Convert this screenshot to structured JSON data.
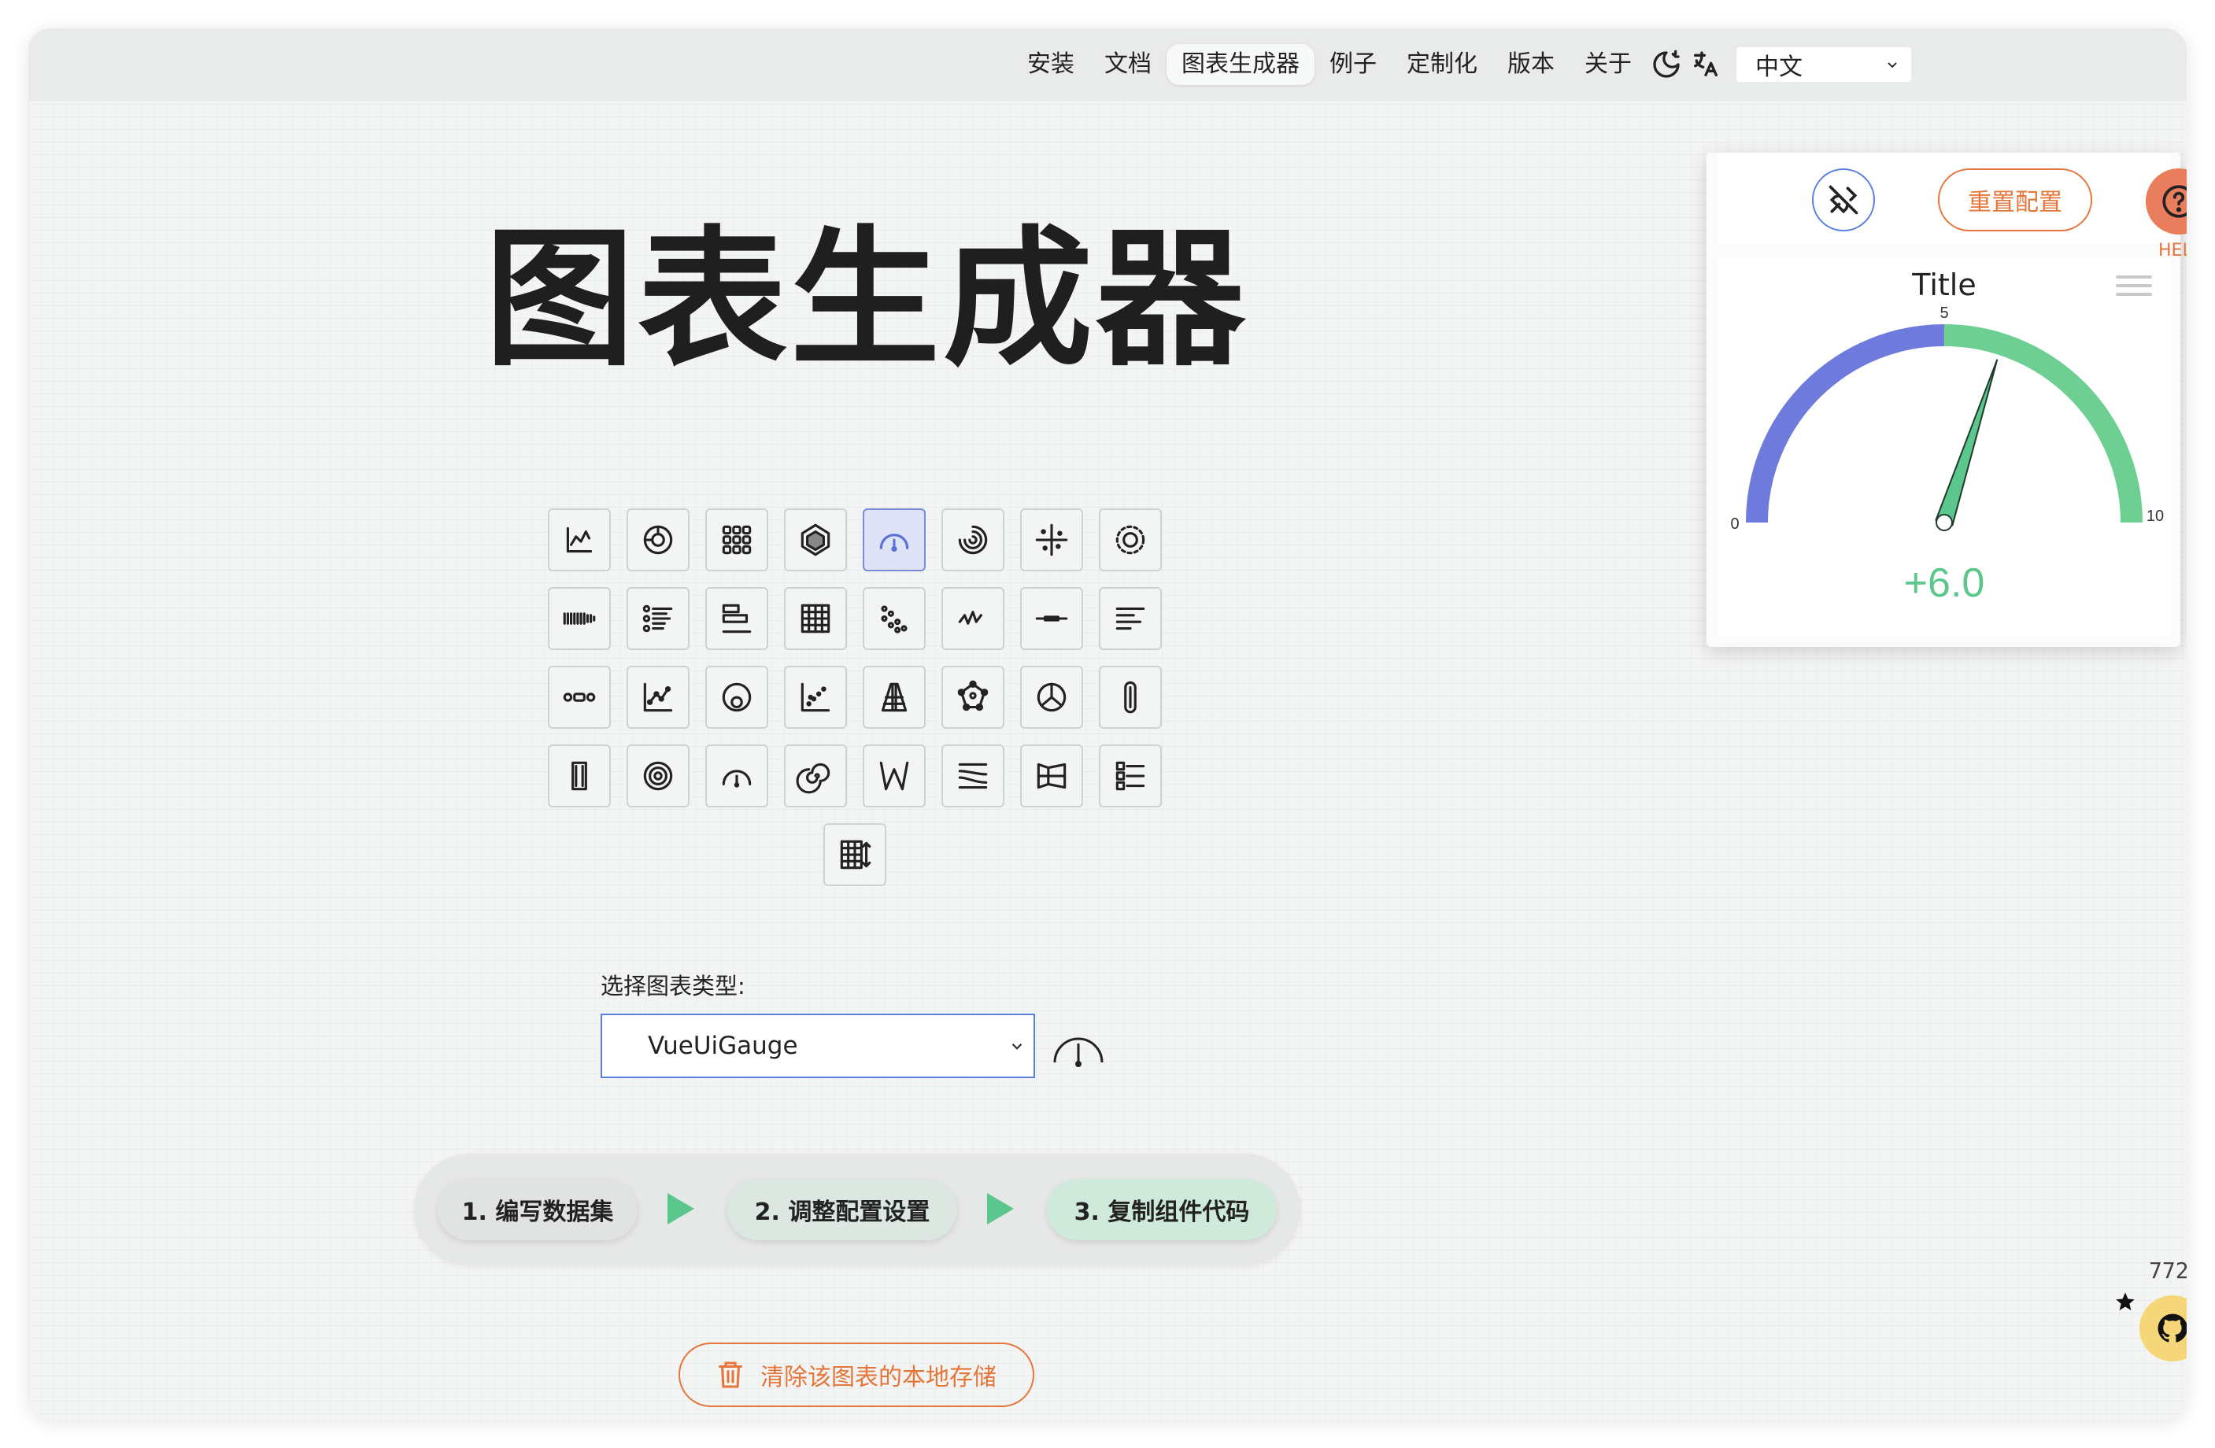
{
  "nav": {
    "items": [
      "安装",
      "文档",
      "图表生成器",
      "例子",
      "定制化",
      "版本",
      "关于"
    ],
    "active_index": 2,
    "language": "中文"
  },
  "page": {
    "title": "图表生成器",
    "select_label": "选择图表类型:",
    "selected_chart": "VueUiGauge",
    "steps": [
      "1. 编写数据集",
      "2. 调整配置设置",
      "3. 复制组件代码"
    ],
    "clear_storage_label": "清除该图表的本地存储"
  },
  "icon_grid": {
    "selected_index": 4,
    "icons": [
      "xy-chart-icon",
      "donut-icon",
      "waffle-icon",
      "radar-icon",
      "gauge-icon",
      "rings-icon",
      "quadrant-icon",
      "onion-icon",
      "sparkbar-icon",
      "sparklist-icon",
      "horizontal-bar-icon",
      "heatmap-icon",
      "scatter-icon",
      "sparkline-icon",
      "slicer-icon",
      "table-sparkline-icon",
      "chestnut-icon",
      "trend-icon",
      "relation-circle-icon",
      "scatter-plot-icon",
      "pyramid-icon",
      "molecule-icon",
      "nested-donuts-icon",
      "thermometer-icon",
      "vertical-bar-icon",
      "concentric-icon",
      "wheel-icon",
      "spiral-icon",
      "stripplot-icon",
      "flow-icon",
      "funnel-icon",
      "list-icon",
      "table-icon"
    ]
  },
  "panel": {
    "reset_label": "重置配置",
    "help_label": "HELP"
  },
  "chart_data": {
    "type": "gauge",
    "title": "Title",
    "value": 6.0,
    "value_label": "+6.0",
    "range": [
      0,
      10
    ],
    "tick_labels": [
      "0",
      "5",
      "10"
    ],
    "segments": [
      {
        "from": 0,
        "to": 5,
        "color": "#6f7bdc"
      },
      {
        "from": 5,
        "to": 10,
        "color": "#6ecf93"
      }
    ],
    "value_color": "#5cc78c"
  },
  "github": {
    "stars": "772"
  },
  "colors": {
    "accent_orange": "#e6753a",
    "accent_blue": "#5b7fe0",
    "accent_green": "#5cc78c"
  }
}
